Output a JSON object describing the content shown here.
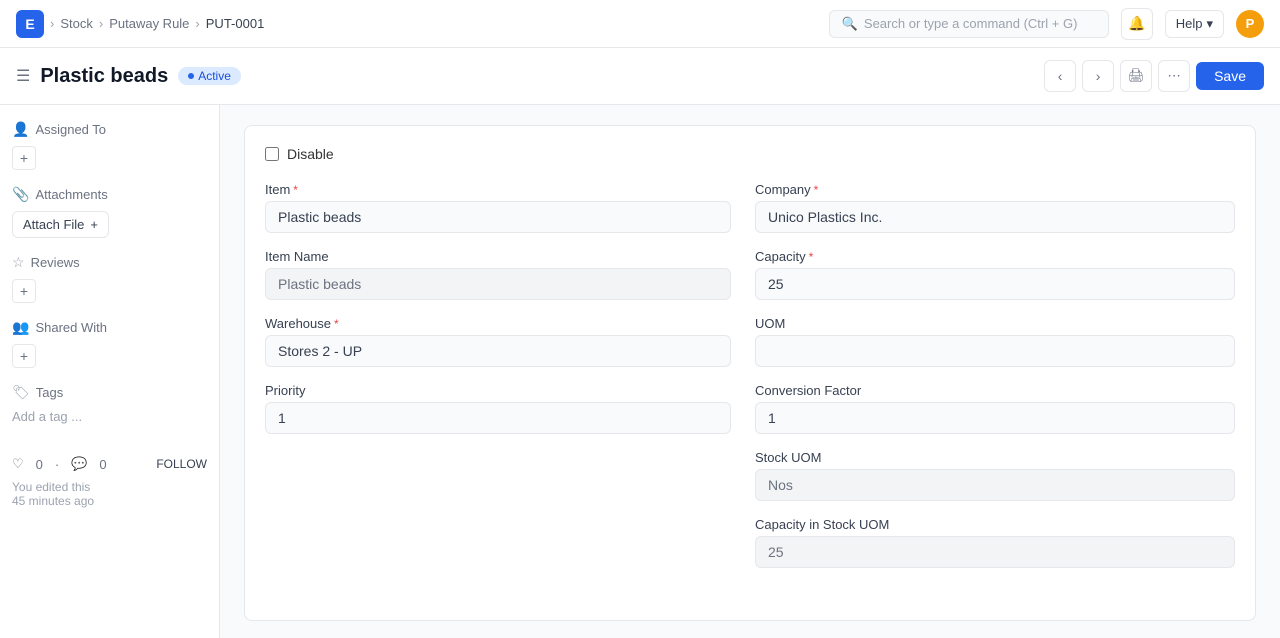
{
  "topbar": {
    "app_icon": "E",
    "breadcrumbs": [
      "Stock",
      "Putaway Rule",
      "PUT-0001"
    ],
    "search_placeholder": "Search or type a command (Ctrl + G)",
    "help_label": "Help",
    "avatar_initial": "P"
  },
  "header": {
    "title": "Plastic beads",
    "status": "Active",
    "save_label": "Save"
  },
  "sidebar": {
    "assigned_to_label": "Assigned To",
    "attachments_label": "Attachments",
    "attach_file_label": "Attach File",
    "reviews_label": "Reviews",
    "shared_with_label": "Shared With",
    "tags_label": "Tags",
    "add_tag_label": "Add a tag ...",
    "likes_count": "0",
    "comments_count": "0",
    "follow_label": "FOLLOW",
    "edit_line1": "You edited this",
    "edit_line2": "45 minutes ago"
  },
  "form": {
    "disable_label": "Disable",
    "item_label": "Item",
    "item_value": "Plastic beads",
    "item_name_label": "Item Name",
    "item_name_value": "Plastic beads",
    "warehouse_label": "Warehouse",
    "warehouse_value": "Stores 2 - UP",
    "priority_label": "Priority",
    "priority_value": "1",
    "company_label": "Company",
    "company_value": "Unico Plastics Inc.",
    "capacity_label": "Capacity",
    "capacity_value": "25",
    "uom_label": "UOM",
    "uom_value": "",
    "conversion_factor_label": "Conversion Factor",
    "conversion_factor_value": "1",
    "stock_uom_label": "Stock UOM",
    "stock_uom_value": "Nos",
    "capacity_stock_uom_label": "Capacity in Stock UOM",
    "capacity_stock_uom_value": "25"
  }
}
